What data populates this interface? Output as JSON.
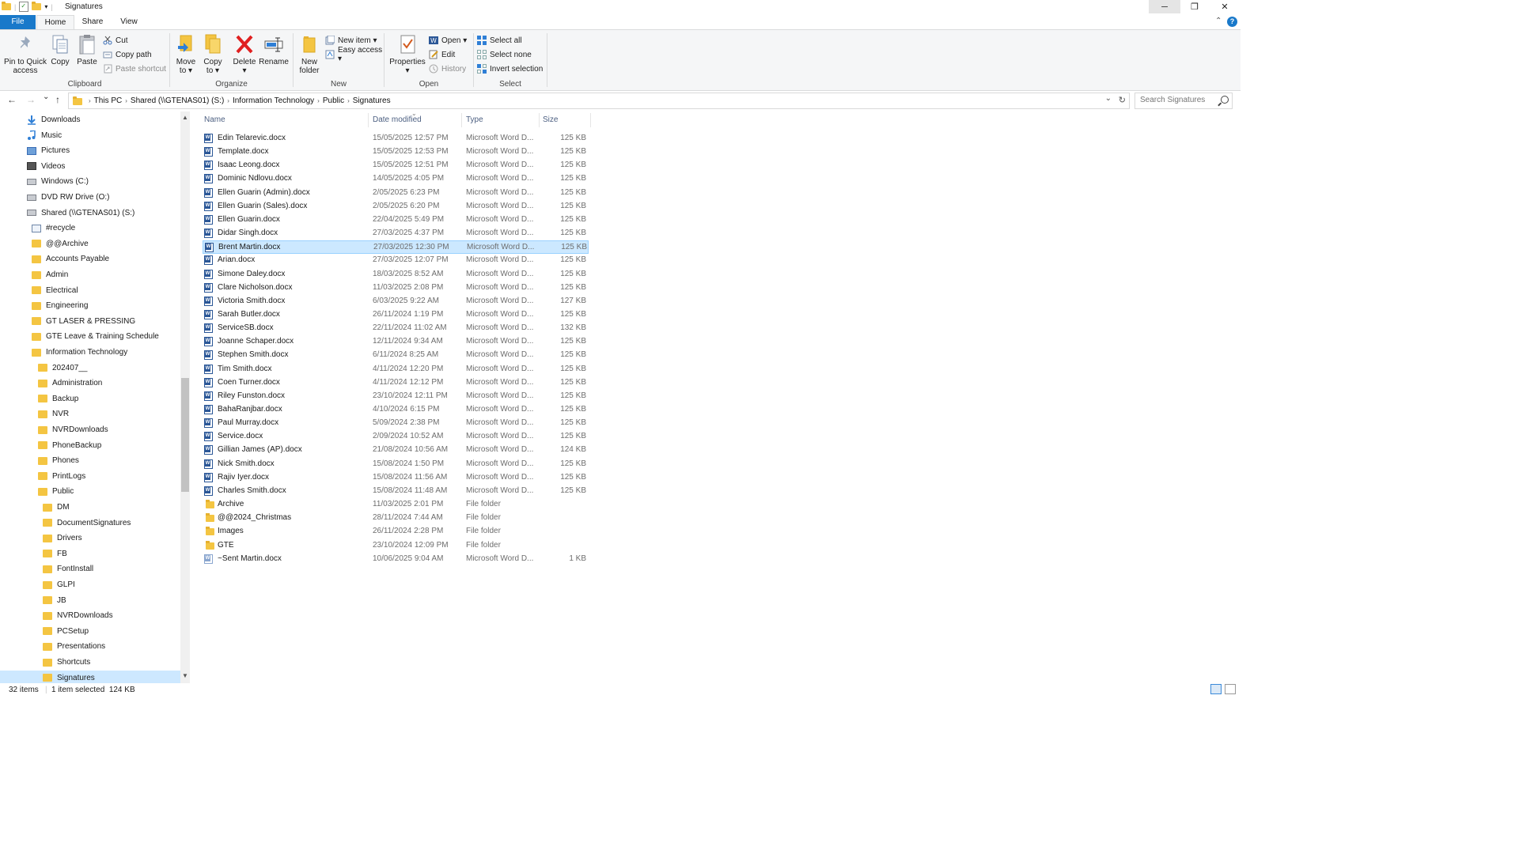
{
  "window": {
    "title": "Signatures",
    "minimize": "─",
    "maximize": "❐",
    "close": "✕"
  },
  "ribbon_tabs": {
    "file": "File",
    "home": "Home",
    "share": "Share",
    "view": "View",
    "collapse": "⌃",
    "help": "?"
  },
  "ribbon": {
    "clipboard": {
      "label": "Clipboard",
      "pin": [
        "Pin to Quick",
        "access"
      ],
      "copy": "Copy",
      "paste": "Paste",
      "cut": "Cut",
      "copy_path": "Copy path",
      "paste_shortcut": "Paste shortcut"
    },
    "organize": {
      "label": "Organize",
      "move_to": [
        "Move",
        "to ▾"
      ],
      "copy_to": [
        "Copy",
        "to ▾"
      ],
      "delete": [
        "Delete",
        "▾"
      ],
      "rename": "Rename"
    },
    "new": {
      "label": "New",
      "new_folder": [
        "New",
        "folder"
      ],
      "new_item": "New item ▾",
      "easy_access": "Easy access ▾"
    },
    "open": {
      "label": "Open",
      "properties": [
        "Properties",
        "▾"
      ],
      "open": "Open ▾",
      "edit": "Edit",
      "history": "History"
    },
    "select": {
      "label": "Select",
      "select_all": "Select all",
      "select_none": "Select none",
      "invert": "Invert selection"
    }
  },
  "address": {
    "back": "←",
    "forward": "→",
    "recent": "⌄",
    "up": "↑",
    "crumbs": [
      "This PC",
      "Shared (\\\\GTENAS01) (S:)",
      "Information Technology",
      "Public",
      "Signatures"
    ],
    "refresh": "↻",
    "dropdown": "⌄",
    "search_placeholder": "Search Signatures"
  },
  "nav": {
    "scroll_up": "▲",
    "scroll_down": "▼",
    "items": [
      {
        "label": "Downloads",
        "icon": "download-icon",
        "indent": 1
      },
      {
        "label": "Music",
        "icon": "music-icon",
        "indent": 1
      },
      {
        "label": "Pictures",
        "icon": "pictures-icon",
        "indent": 1
      },
      {
        "label": "Videos",
        "icon": "videos-icon",
        "indent": 1
      },
      {
        "label": "Windows (C:)",
        "icon": "drive-icon",
        "indent": 1
      },
      {
        "label": "DVD RW Drive (O:)",
        "icon": "dvd-drive-icon",
        "indent": 1
      },
      {
        "label": "Shared (\\\\GTENAS01) (S:)",
        "icon": "network-drive-icon",
        "indent": 1
      },
      {
        "label": "#recycle",
        "icon": "recycle-folder-icon",
        "indent": 2
      },
      {
        "label": "@@Archive",
        "icon": "folder-icon",
        "indent": 2
      },
      {
        "label": "Accounts Payable",
        "icon": "folder-icon",
        "indent": 2
      },
      {
        "label": "Admin",
        "icon": "folder-icon",
        "indent": 2
      },
      {
        "label": "Electrical",
        "icon": "folder-icon",
        "indent": 2
      },
      {
        "label": "Engineering",
        "icon": "folder-icon",
        "indent": 2
      },
      {
        "label": "GT LASER & PRESSING",
        "icon": "folder-icon",
        "indent": 2
      },
      {
        "label": "GTE Leave & Training Schedule",
        "icon": "folder-icon",
        "indent": 2
      },
      {
        "label": "Information Technology",
        "icon": "folder-icon",
        "indent": 2
      },
      {
        "label": "202407__",
        "icon": "folder-icon",
        "indent": 3
      },
      {
        "label": "Administration",
        "icon": "folder-icon",
        "indent": 3
      },
      {
        "label": "Backup",
        "icon": "folder-icon",
        "indent": 3
      },
      {
        "label": "NVR",
        "icon": "folder-icon",
        "indent": 3
      },
      {
        "label": "NVRDownloads",
        "icon": "folder-icon",
        "indent": 3
      },
      {
        "label": "PhoneBackup",
        "icon": "folder-icon",
        "indent": 3
      },
      {
        "label": "Phones",
        "icon": "folder-icon",
        "indent": 3
      },
      {
        "label": "PrintLogs",
        "icon": "folder-icon",
        "indent": 3
      },
      {
        "label": "Public",
        "icon": "folder-icon",
        "indent": 3
      },
      {
        "label": "DM",
        "icon": "folder-icon",
        "indent": 4
      },
      {
        "label": "DocumentSignatures",
        "icon": "folder-icon",
        "indent": 4
      },
      {
        "label": "Drivers",
        "icon": "folder-icon",
        "indent": 4
      },
      {
        "label": "FB",
        "icon": "folder-icon",
        "indent": 4
      },
      {
        "label": "FontInstall",
        "icon": "folder-icon",
        "indent": 4
      },
      {
        "label": "GLPI",
        "icon": "folder-icon",
        "indent": 4
      },
      {
        "label": "JB",
        "icon": "folder-icon",
        "indent": 4
      },
      {
        "label": "NVRDownloads",
        "icon": "folder-icon",
        "indent": 4
      },
      {
        "label": "PCSetup",
        "icon": "folder-icon",
        "indent": 4
      },
      {
        "label": "Presentations",
        "icon": "folder-icon",
        "indent": 4
      },
      {
        "label": "Shortcuts",
        "icon": "folder-icon",
        "indent": 4
      },
      {
        "label": "Signatures",
        "icon": "folder-icon",
        "indent": 4,
        "selected": true
      }
    ]
  },
  "columns": {
    "name": "Name",
    "date": "Date modified",
    "type": "Type",
    "size": "Size",
    "sort_indicator": "⌄"
  },
  "files": [
    {
      "name": "Edin Telarevic.docx",
      "date": "15/05/2025 12:57 PM",
      "type": "Microsoft Word D...",
      "size": "125 KB",
      "kind": "doc"
    },
    {
      "name": "Template.docx",
      "date": "15/05/2025 12:53 PM",
      "type": "Microsoft Word D...",
      "size": "125 KB",
      "kind": "doc"
    },
    {
      "name": "Isaac Leong.docx",
      "date": "15/05/2025 12:51 PM",
      "type": "Microsoft Word D...",
      "size": "125 KB",
      "kind": "doc"
    },
    {
      "name": "Dominic Ndlovu.docx",
      "date": "14/05/2025 4:05 PM",
      "type": "Microsoft Word D...",
      "size": "125 KB",
      "kind": "doc"
    },
    {
      "name": "Ellen Guarin (Admin).docx",
      "date": "2/05/2025 6:23 PM",
      "type": "Microsoft Word D...",
      "size": "125 KB",
      "kind": "doc"
    },
    {
      "name": "Ellen Guarin (Sales).docx",
      "date": "2/05/2025 6:20 PM",
      "type": "Microsoft Word D...",
      "size": "125 KB",
      "kind": "doc"
    },
    {
      "name": "Ellen Guarin.docx",
      "date": "22/04/2025 5:49 PM",
      "type": "Microsoft Word D...",
      "size": "125 KB",
      "kind": "doc"
    },
    {
      "name": "Didar Singh.docx",
      "date": "27/03/2025 4:37 PM",
      "type": "Microsoft Word D...",
      "size": "125 KB",
      "kind": "doc"
    },
    {
      "name": "Brent Martin.docx",
      "date": "27/03/2025 12:30 PM",
      "type": "Microsoft Word D...",
      "size": "125 KB",
      "kind": "doc",
      "selected": true
    },
    {
      "name": "Arian.docx",
      "date": "27/03/2025 12:07 PM",
      "type": "Microsoft Word D...",
      "size": "125 KB",
      "kind": "doc"
    },
    {
      "name": "Simone Daley.docx",
      "date": "18/03/2025 8:52 AM",
      "type": "Microsoft Word D...",
      "size": "125 KB",
      "kind": "doc"
    },
    {
      "name": "Clare Nicholson.docx",
      "date": "11/03/2025 2:08 PM",
      "type": "Microsoft Word D...",
      "size": "125 KB",
      "kind": "doc"
    },
    {
      "name": "Victoria Smith.docx",
      "date": "6/03/2025 9:22 AM",
      "type": "Microsoft Word D...",
      "size": "127 KB",
      "kind": "doc"
    },
    {
      "name": "Sarah Butler.docx",
      "date": "26/11/2024 1:19 PM",
      "type": "Microsoft Word D...",
      "size": "125 KB",
      "kind": "doc"
    },
    {
      "name": "ServiceSB.docx",
      "date": "22/11/2024 11:02 AM",
      "type": "Microsoft Word D...",
      "size": "132 KB",
      "kind": "doc"
    },
    {
      "name": "Joanne Schaper.docx",
      "date": "12/11/2024 9:34 AM",
      "type": "Microsoft Word D...",
      "size": "125 KB",
      "kind": "doc"
    },
    {
      "name": "Stephen Smith.docx",
      "date": "6/11/2024 8:25 AM",
      "type": "Microsoft Word D...",
      "size": "125 KB",
      "kind": "doc"
    },
    {
      "name": "Tim Smith.docx",
      "date": "4/11/2024 12:20 PM",
      "type": "Microsoft Word D...",
      "size": "125 KB",
      "kind": "doc"
    },
    {
      "name": "Coen Turner.docx",
      "date": "4/11/2024 12:12 PM",
      "type": "Microsoft Word D...",
      "size": "125 KB",
      "kind": "doc"
    },
    {
      "name": "Riley Funston.docx",
      "date": "23/10/2024 12:11 PM",
      "type": "Microsoft Word D...",
      "size": "125 KB",
      "kind": "doc"
    },
    {
      "name": "BahaRanjbar.docx",
      "date": "4/10/2024 6:15 PM",
      "type": "Microsoft Word D...",
      "size": "125 KB",
      "kind": "doc"
    },
    {
      "name": "Paul Murray.docx",
      "date": "5/09/2024 2:38 PM",
      "type": "Microsoft Word D...",
      "size": "125 KB",
      "kind": "doc"
    },
    {
      "name": "Service.docx",
      "date": "2/09/2024 10:52 AM",
      "type": "Microsoft Word D...",
      "size": "125 KB",
      "kind": "doc"
    },
    {
      "name": "Gillian James (AP).docx",
      "date": "21/08/2024 10:56 AM",
      "type": "Microsoft Word D...",
      "size": "124 KB",
      "kind": "doc"
    },
    {
      "name": "Nick Smith.docx",
      "date": "15/08/2024 1:50 PM",
      "type": "Microsoft Word D...",
      "size": "125 KB",
      "kind": "doc"
    },
    {
      "name": "Rajiv Iyer.docx",
      "date": "15/08/2024 11:56 AM",
      "type": "Microsoft Word D...",
      "size": "125 KB",
      "kind": "doc"
    },
    {
      "name": "Charles Smith.docx",
      "date": "15/08/2024 11:48 AM",
      "type": "Microsoft Word D...",
      "size": "125 KB",
      "kind": "doc"
    },
    {
      "name": "Archive",
      "date": "11/03/2025 2:01 PM",
      "type": "File folder",
      "size": "",
      "kind": "folder"
    },
    {
      "name": "@@2024_Christmas",
      "date": "28/11/2024 7:44 AM",
      "type": "File folder",
      "size": "",
      "kind": "folder"
    },
    {
      "name": "Images",
      "date": "26/11/2024 2:28 PM",
      "type": "File folder",
      "size": "",
      "kind": "folder"
    },
    {
      "name": "GTE",
      "date": "23/10/2024 12:09 PM",
      "type": "File folder",
      "size": "",
      "kind": "folder"
    },
    {
      "name": "~Sent Martin.docx",
      "date": "10/06/2025 9:04 AM",
      "type": "Microsoft Word D...",
      "size": "1 KB",
      "kind": "tempdoc"
    }
  ],
  "status": {
    "count": "32 items",
    "selection": "1 item selected  124 KB"
  }
}
